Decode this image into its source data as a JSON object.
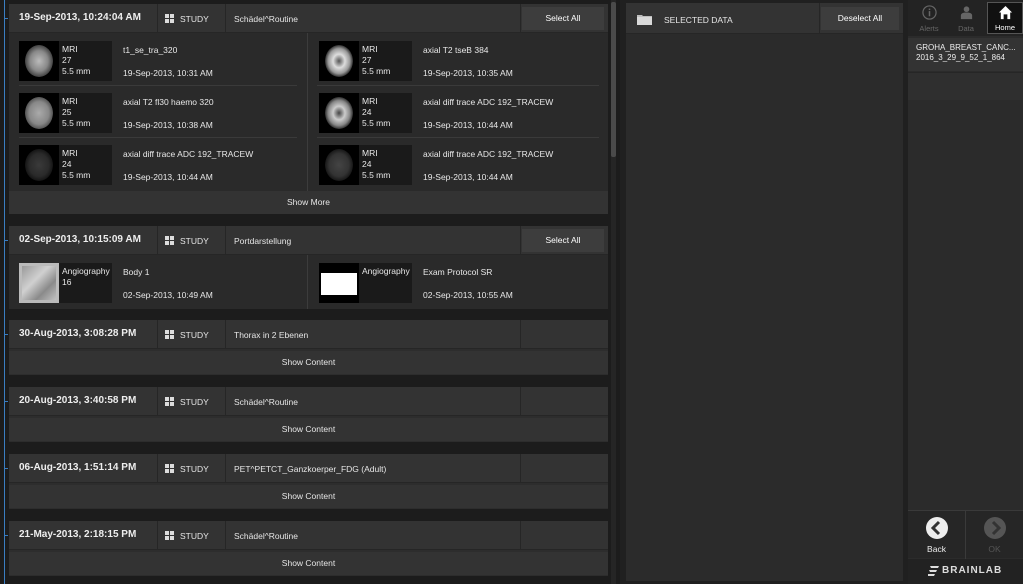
{
  "studies": [
    {
      "date": "19-Sep-2013, 10:24:04 AM",
      "type": "STUDY",
      "description": "Schädel^Routine",
      "select_label": "Select All",
      "series": [
        {
          "modality": "MRI",
          "count": "27",
          "thickness": "5.5 mm",
          "name": "t1_se_tra_320",
          "date": "19-Sep-2013, 10:31 AM"
        },
        {
          "modality": "MRI",
          "count": "27",
          "thickness": "5.5 mm",
          "name": "axial T2 tseB 384",
          "date": "19-Sep-2013, 10:35 AM"
        },
        {
          "modality": "MRI",
          "count": "25",
          "thickness": "5.5 mm",
          "name": "axial T2 fl30 haemo 320",
          "date": "19-Sep-2013, 10:38 AM"
        },
        {
          "modality": "MRI",
          "count": "24",
          "thickness": "5.5 mm",
          "name": "axial diff trace ADC 192_TRACEW",
          "date": "19-Sep-2013, 10:44 AM"
        },
        {
          "modality": "MRI",
          "count": "24",
          "thickness": "5.5 mm",
          "name": "axial diff trace ADC 192_TRACEW",
          "date": "19-Sep-2013, 10:44 AM"
        },
        {
          "modality": "MRI",
          "count": "24",
          "thickness": "5.5 mm",
          "name": "axial diff trace ADC 192_TRACEW",
          "date": "19-Sep-2013, 10:44 AM"
        }
      ],
      "footer": "Show More"
    },
    {
      "date": "02-Sep-2013, 10:15:09 AM",
      "type": "STUDY",
      "description": "Portdarstellung",
      "select_label": "Select All",
      "series": [
        {
          "modality": "Angiography",
          "count": "16",
          "thickness": "",
          "name": "Body 1",
          "date": "02-Sep-2013, 10:49 AM"
        },
        {
          "modality": "Angiography",
          "count": "",
          "thickness": "",
          "name": "Exam Protocol SR",
          "date": "02-Sep-2013, 10:55 AM"
        }
      ]
    },
    {
      "date": "30-Aug-2013, 3:08:28 PM",
      "type": "STUDY",
      "description": "Thorax in 2 Ebenen",
      "footer": "Show Content"
    },
    {
      "date": "20-Aug-2013, 3:40:58 PM",
      "type": "STUDY",
      "description": "Schädel^Routine",
      "footer": "Show Content"
    },
    {
      "date": "06-Aug-2013, 1:51:14 PM",
      "type": "STUDY",
      "description": "PET^PETCT_Ganzkoerper_FDG (Adult)",
      "footer": "Show Content"
    },
    {
      "date": "21-May-2013, 2:18:15 PM",
      "type": "STUDY",
      "description": "Schädel^Routine",
      "footer": "Show Content"
    }
  ],
  "selected_panel": {
    "title": "SELECTED DATA",
    "deselect_label": "Deselect All"
  },
  "topbar": {
    "alerts": "Alerts",
    "data": "Data",
    "home": "Home"
  },
  "patient": {
    "name": "GROHA_BREAST_CANC...",
    "id": "2016_3_29_9_52_1_864"
  },
  "nav": {
    "back": "Back",
    "ok": "OK"
  },
  "brand": "BRAINLAB"
}
